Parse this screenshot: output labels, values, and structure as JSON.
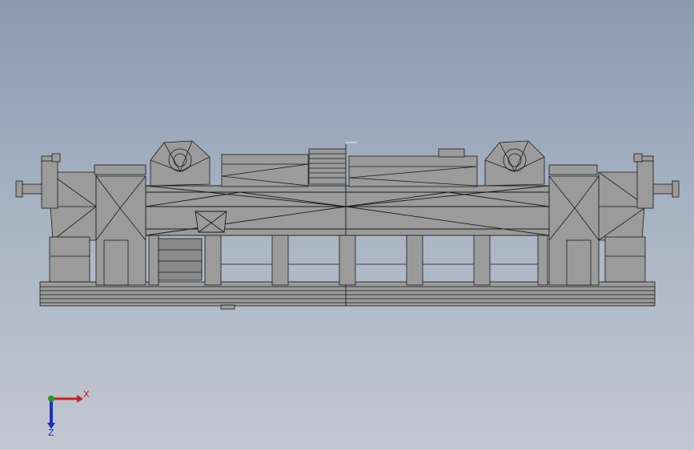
{
  "viewport": {
    "background_top": "#8c9ab0",
    "background_bottom": "#c2c8d2",
    "model_fill": "#9b9b9b",
    "edge_color": "#1a1a1a",
    "shade_color": "#8a8a8a"
  },
  "triad": {
    "x_label": "X",
    "z_label": "Z",
    "x_color": "#d21e1e",
    "y_color": "#1aa01a",
    "z_color": "#1e2fbf"
  }
}
